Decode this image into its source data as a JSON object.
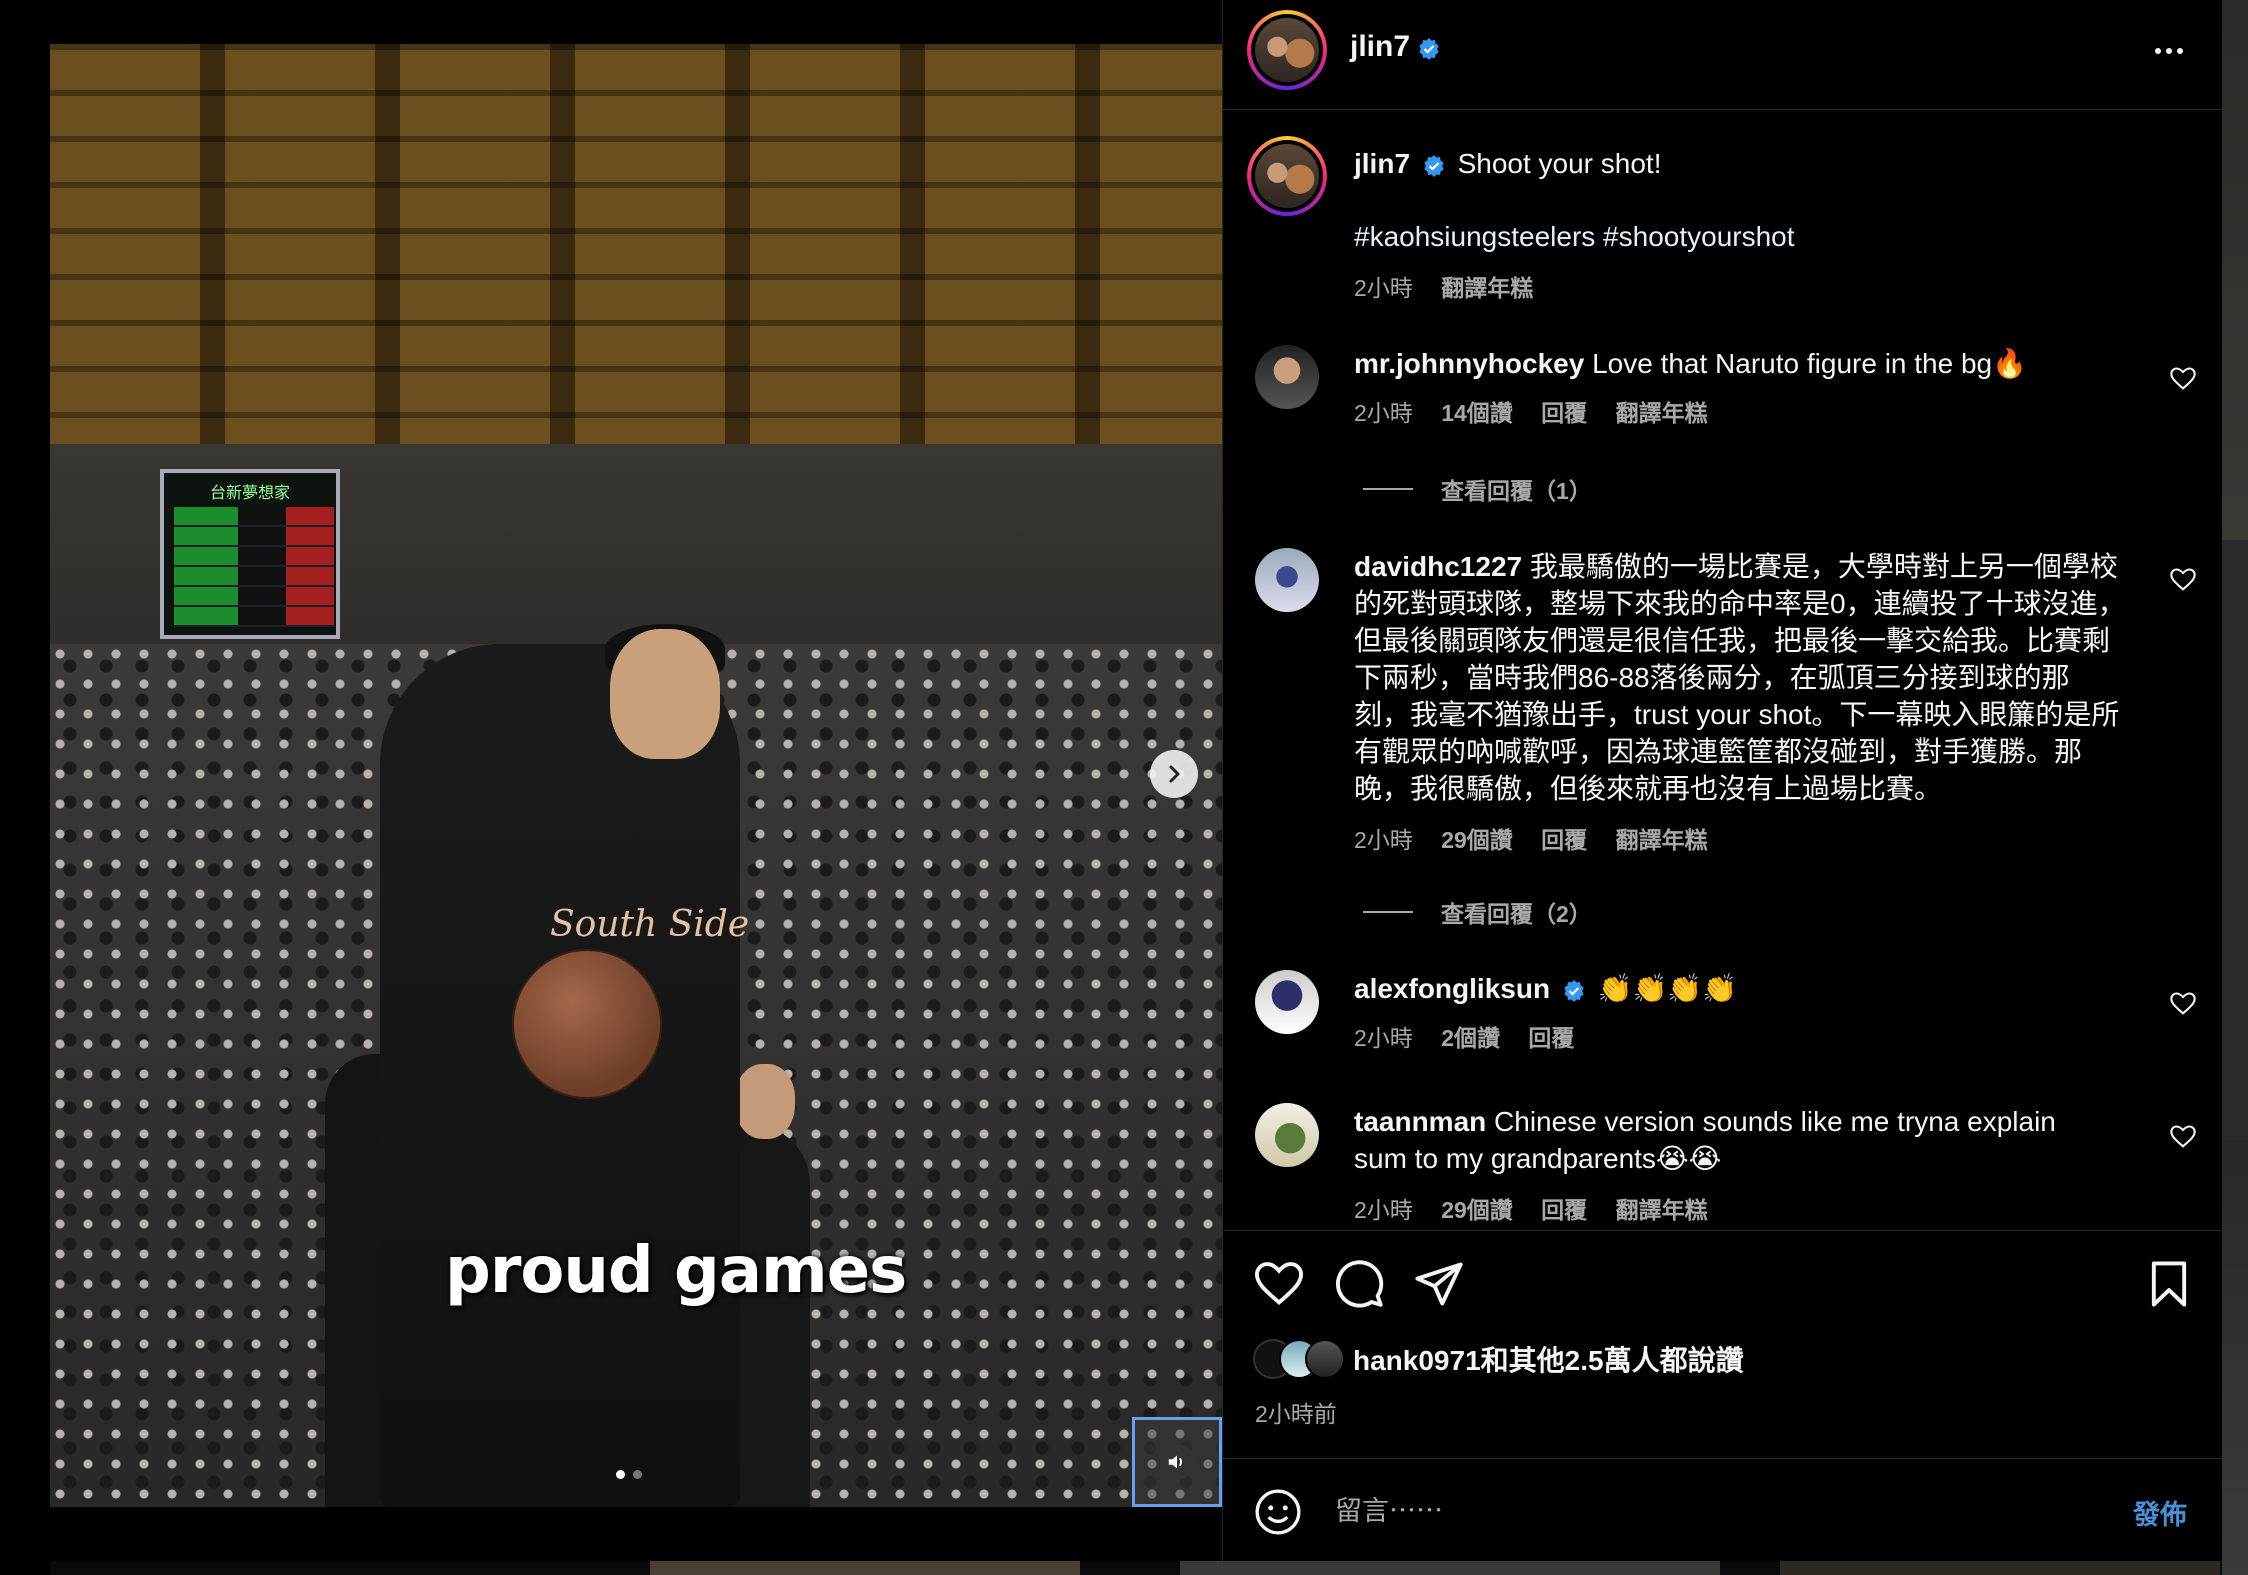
{
  "post": {
    "username": "jlin7",
    "caption_text": "Shoot your shot!",
    "hashtags": "#kaohsiungsteelers #shootyourshot",
    "time": "2小時",
    "translate": "翻譯年糕"
  },
  "media": {
    "overlay_caption": "proud games",
    "scoreboard_title": "台新夢想家",
    "jersey_text": "South Side",
    "icons": {
      "next": "chevron-right-icon",
      "mute": "speaker-icon"
    }
  },
  "comments": [
    {
      "username": "mr.johnnyhockey",
      "text": "Love that Naruto figure in the bg🔥",
      "time": "2小時",
      "likes": "14個讚",
      "reply": "回覆",
      "translate": "翻譯年糕",
      "view_replies": "查看回覆（1）"
    },
    {
      "username": "davidhc1227",
      "text_lines": [
        "我最驕傲的一場比賽是，大學時對上另一個學校",
        "的死對頭球隊，整場下來我的命中率是0，連續投了十球沒進，",
        "但最後關頭隊友們還是很信任我，把最後一擊交給我。比賽剩",
        "下兩秒，當時我們86-88落後兩分，在弧頂三分接到球的那",
        "刻，我毫不猶豫出手，trust your shot。下一幕映入眼簾的是所",
        "有觀眾的吶喊歡呼，因為球連籃筐都沒碰到，對手獲勝。那",
        "晚，我很驕傲，但後來就再也沒有上過場比賽。"
      ],
      "time": "2小時",
      "likes": "29個讚",
      "reply": "回覆",
      "translate": "翻譯年糕",
      "view_replies": "查看回覆（2）"
    },
    {
      "username": "alexfongliksun",
      "text": "👏👏👏👏",
      "time": "2小時",
      "likes": "2個讚",
      "reply": "回覆"
    },
    {
      "username": "taannman",
      "text_lines": [
        "Chinese version sounds like me tryna explain",
        "sum to my grandparents😭😭"
      ],
      "time": "2小時",
      "likes": "29個讚",
      "reply": "回覆",
      "translate": "翻譯年糕"
    }
  ],
  "engagement": {
    "likes_text": "hank0971和其他2.5萬人都說讚",
    "time_ago": "2小時前"
  },
  "comment_box": {
    "placeholder": "留言⋯⋯",
    "post_label": "發佈"
  },
  "colors": {
    "accent": "#4a90d9",
    "verified": "#3897f0",
    "muted": "#a8a8a8"
  }
}
